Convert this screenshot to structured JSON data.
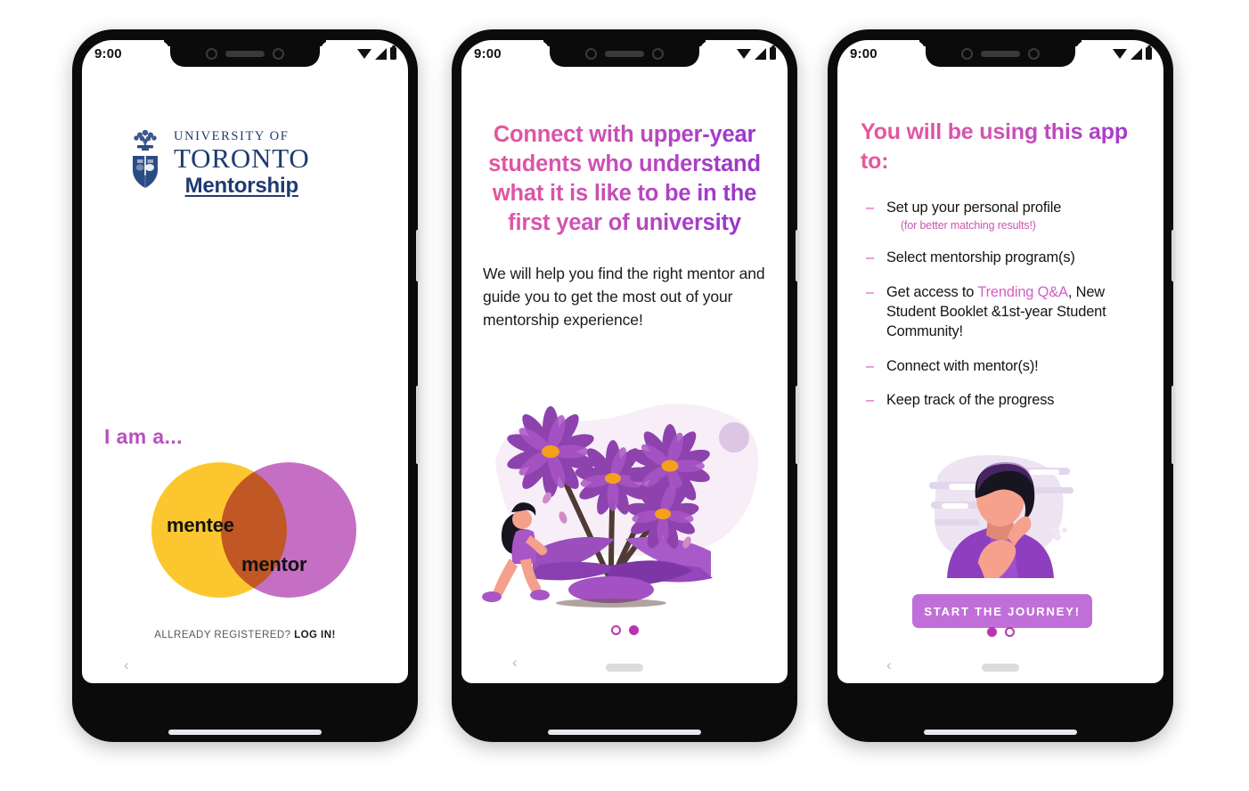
{
  "meta": {
    "app_name": "University of Toronto Mentorship",
    "colors": {
      "uoft_blue": "#1f3a72",
      "pink": "#e8569a",
      "purple": "#8e33c9",
      "magenta": "#b934b0",
      "mentee_yellow": "#fcc72e",
      "mentor_purple": "#c46fc4",
      "cta_purple": "#c06fd8"
    }
  },
  "status_bar": {
    "time": "9:00",
    "icons": [
      "wifi-icon",
      "signal-icon",
      "battery-icon"
    ]
  },
  "screen1": {
    "logo": {
      "crest_alt": "uoft-crest-icon",
      "line1": "UNIVERSITY OF",
      "line2": "TORONTO",
      "line3": "Mentorship"
    },
    "prompt": "I am a...",
    "venn": {
      "left_label": "mentee",
      "right_label": "mentor"
    },
    "footer": {
      "text": "ALLREADY REGISTERED?",
      "link": "LOG IN!"
    },
    "back_icon": "‹"
  },
  "screen2": {
    "heading": "Connect  with upper-year students who understand what it is like to be in the first year of university",
    "body": "We will help you find the right mentor and guide you to get the most out of your mentorship experience!",
    "illustration": "flowers-and-walking-person-illustration",
    "dots": [
      "hollow",
      "filled"
    ],
    "back_icon": "‹"
  },
  "screen3": {
    "heading": "You will be using this app to:",
    "items": [
      {
        "dash": "–",
        "text": "Set up your personal profile",
        "note": "(for better  matching results!)"
      },
      {
        "dash": "–",
        "text": "Select mentorship program(s)",
        "note": ""
      },
      {
        "dash": "–",
        "text_before": "Get access  to ",
        "highlight": "Trending Q&A",
        "text_after": ", New Student Booklet &1st-year Student Community!",
        "note": ""
      },
      {
        "dash": "–",
        "text": "Connect with mentor(s)!",
        "note": ""
      },
      {
        "dash": "–",
        "text": "Keep track of the progress",
        "note": ""
      }
    ],
    "illustration": "thinking-person-illustration",
    "cta_label": "START THE JOURNEY!",
    "dots": [
      "filled",
      "hollow"
    ],
    "back_icon": "‹"
  }
}
